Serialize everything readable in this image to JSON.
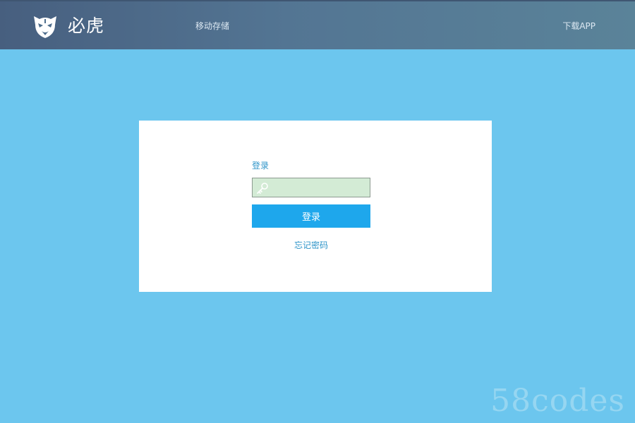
{
  "header": {
    "brand": "必虎",
    "logo_icon": "tiger-head-icon",
    "nav": {
      "storage": "移动存储",
      "download_app": "下载APP"
    }
  },
  "login": {
    "title": "登录",
    "key_field": {
      "icon": "key-icon",
      "value": "",
      "placeholder": ""
    },
    "button_label": "登录",
    "forgot_password": "忘记密码"
  },
  "watermark": "58codes",
  "colors": {
    "background": "#6cc6ee",
    "header": "#4d6d8c",
    "button": "#1ea7ec",
    "link": "#2f95c9",
    "input_bg": "#d3ebd5"
  }
}
